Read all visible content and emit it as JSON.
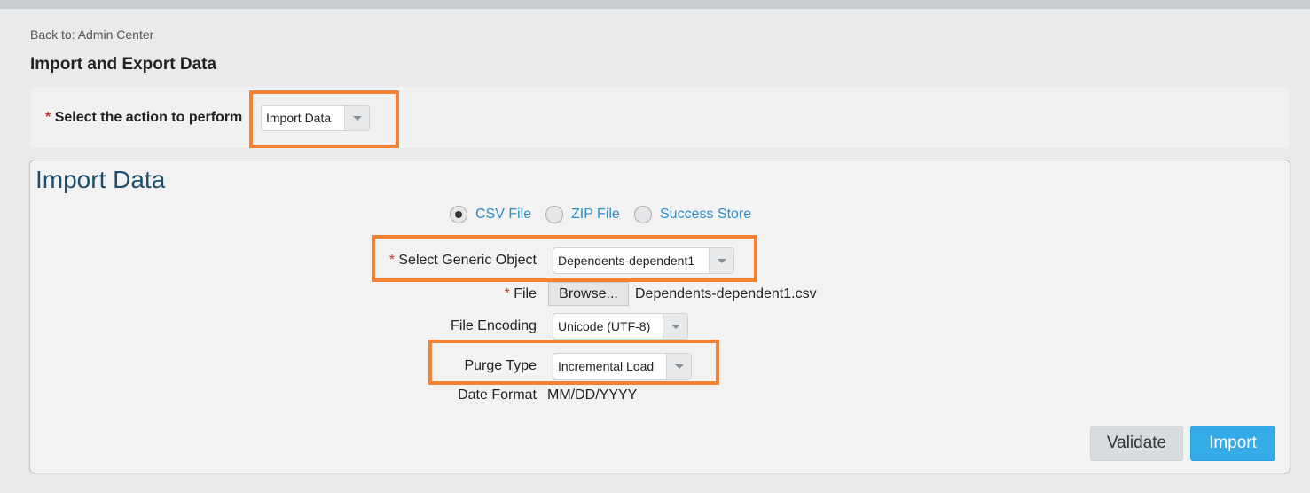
{
  "header": {
    "back_link": "Back to: Admin Center",
    "title": "Import and Export Data"
  },
  "action": {
    "required_mark": "*",
    "label": "Select the action to perform",
    "selected": "Import Data"
  },
  "import_panel": {
    "title": "Import Data",
    "file_types": [
      {
        "label": "CSV File",
        "selected": true
      },
      {
        "label": "ZIP File",
        "selected": false
      },
      {
        "label": "Success Store",
        "selected": false
      }
    ],
    "generic_object": {
      "required_mark": "*",
      "label": "Select Generic Object",
      "selected": "Dependents-dependent1"
    },
    "file": {
      "required_mark": "*",
      "label": "File",
      "browse_label": "Browse...",
      "filename": "Dependents-dependent1.csv"
    },
    "encoding": {
      "label": "File Encoding",
      "selected": "Unicode (UTF-8)"
    },
    "purge_type": {
      "label": "Purge Type",
      "selected": "Incremental Load"
    },
    "date_format": {
      "label": "Date Format",
      "value": "MM/DD/YYYY"
    },
    "buttons": {
      "validate": "Validate",
      "import": "Import"
    }
  },
  "colors": {
    "highlight": "#f58233",
    "primary_button": "#35abe8",
    "link": "#2d8fc8",
    "required": "#c0392b",
    "panel_title": "#1d4e6e"
  }
}
